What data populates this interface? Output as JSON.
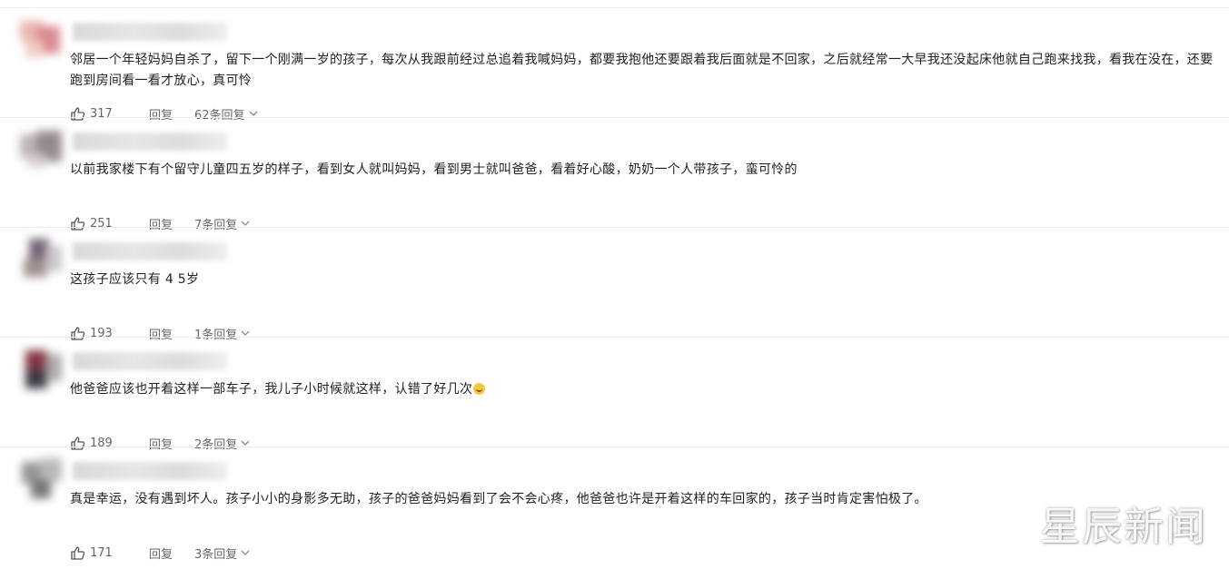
{
  "comments": [
    {
      "text": "邻居一个年轻妈妈自杀了，留下一个刚满一岁的孩子，每次从我跟前经过总追着我喊妈妈，都要我抱他还要跟着我后面就是不回家，之后就经常一大早我还没起床他就自己跑来找我，看我在没在，还要跑到房间看一看才放心，真可怜",
      "likes": "317",
      "reply_label": "回复",
      "replies_label": "62条回复"
    },
    {
      "text": "以前我家楼下有个留守儿童四五岁的样子，看到女人就叫妈妈，看到男士就叫爸爸，看着好心酸，奶奶一个人带孩子，蛮可怜的",
      "likes": "251",
      "reply_label": "回复",
      "replies_label": "7条回复"
    },
    {
      "text": "这孩子应该只有 4 5岁",
      "likes": "193",
      "reply_label": "回复",
      "replies_label": "1条回复"
    },
    {
      "text": "他爸爸应该也开着这样一部车子，我儿子小时候就这样，认错了好几次",
      "likes": "189",
      "reply_label": "回复",
      "replies_label": "2条回复"
    },
    {
      "text": "真是幸运，没有遇到坏人。孩子小小的身影多无助，孩子的爸爸妈妈看到了会不会心疼，他爸爸也许是开着这样的车回家的，孩子当时肯定害怕极了。",
      "likes": "171",
      "reply_label": "回复",
      "replies_label": "3条回复"
    }
  ],
  "watermark": "星辰新闻",
  "icons": {
    "like": "thumbs-up-icon",
    "expand": "chevron-down-icon",
    "emoji": "laughing-emoji-icon"
  }
}
